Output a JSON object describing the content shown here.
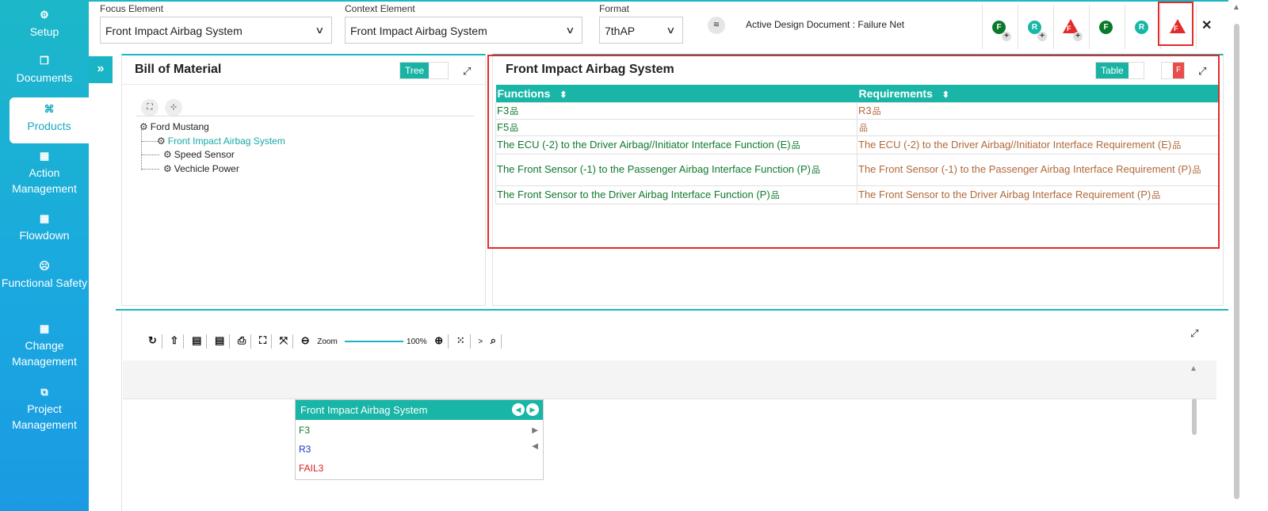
{
  "sidebar": {
    "items": [
      {
        "label": "Setup",
        "icon": "cogs-icon",
        "glyph": "⚙"
      },
      {
        "label": "Documents",
        "icon": "documents-icon",
        "glyph": "❐"
      },
      {
        "label": "Products",
        "icon": "products-icon",
        "glyph": "⌘"
      },
      {
        "label": "Action Management",
        "icon": "action-icon",
        "glyph": "▦"
      },
      {
        "label": "Flowdown",
        "icon": "flowdown-icon",
        "glyph": "▦"
      },
      {
        "label": "Functional Safety",
        "icon": "safety-icon",
        "glyph": "☹"
      },
      {
        "label": "Change Management",
        "icon": "change-icon",
        "glyph": "▦"
      },
      {
        "label": "Project Management",
        "icon": "project-icon",
        "glyph": "⧉"
      }
    ],
    "active_index": 2,
    "expand_glyph": "»"
  },
  "header": {
    "focus_label": "Focus Element",
    "focus_value": "Front Impact Airbag System",
    "context_label": "Context Element",
    "context_value": "Front Impact Airbag System",
    "format_label": "Format",
    "format_value": "7thAP",
    "active_doc": "Active Design Document : Failure Net",
    "close": "✕",
    "layers_glyph": "≋",
    "chevron": "∨",
    "tools": [
      {
        "letter": "F",
        "kind": "green-circle-plus"
      },
      {
        "letter": "R",
        "kind": "teal-circle-plus"
      },
      {
        "letter": "F",
        "kind": "red-triangle-plus"
      },
      {
        "letter": "F",
        "kind": "green-circle"
      },
      {
        "letter": "R",
        "kind": "teal-circle"
      },
      {
        "letter": "F",
        "kind": "red-triangle"
      }
    ],
    "plus_glyph": "+"
  },
  "bom": {
    "title": "Bill of Material",
    "toggle_label": "Tree",
    "expand_all_glyph": "⛶",
    "collapse_all_glyph": "⊹",
    "nodes": [
      {
        "label": "Ford Mustang"
      },
      {
        "label": "Front Impact Airbag System"
      },
      {
        "label": "Speed Sensor"
      },
      {
        "label": "Vechicle Power"
      }
    ]
  },
  "detail": {
    "title": "Front Impact Airbag System",
    "toggle_label": "Table",
    "flag_label": "F",
    "columns": [
      "Functions",
      "Requirements"
    ],
    "sort_glyph": "⬍",
    "rows": [
      {
        "function": "F3",
        "requirement": "R3"
      },
      {
        "function": "F5",
        "requirement": ""
      },
      {
        "function": "The ECU (-2) to the Driver Airbag//Initiator Interface Function (E)",
        "requirement": "The ECU (-2) to the Driver Airbag//Initiator Interface Requirement (E)"
      },
      {
        "function": "The Front Sensor (-1) to the Passenger Airbag Interface Function (P)",
        "requirement": "The Front Sensor (-1) to the Passenger Airbag Interface Requirement (P)"
      },
      {
        "function": "The Front Sensor to the Driver Airbag Interface Function (P)",
        "requirement": "The Front Sensor to the Driver Airbag Interface Requirement (P)"
      }
    ],
    "tree_glyph": "品"
  },
  "diagram": {
    "toolbar": {
      "refresh": "↻",
      "upload": "⇧",
      "svg1": "▤",
      "svg2": "▤",
      "print": "⎙",
      "fit": "⛶",
      "fullscreen": "⤧",
      "zoom_out": "⊖",
      "zoom_label": "Zoom",
      "zoom_value": "100%",
      "zoom_in": "⊕",
      "grid": "⁙",
      "search": "⌕",
      "prefix": ">"
    },
    "expand_glyph": "⤢",
    "node": {
      "title": "Front Impact Airbag System",
      "rows": [
        {
          "label": "F3",
          "color": "#107a2e"
        },
        {
          "label": "R3",
          "color": "#2030c8"
        },
        {
          "label": "FAIL3",
          "color": "#d61f1f"
        }
      ],
      "prev": "◀",
      "next": "▶"
    }
  }
}
